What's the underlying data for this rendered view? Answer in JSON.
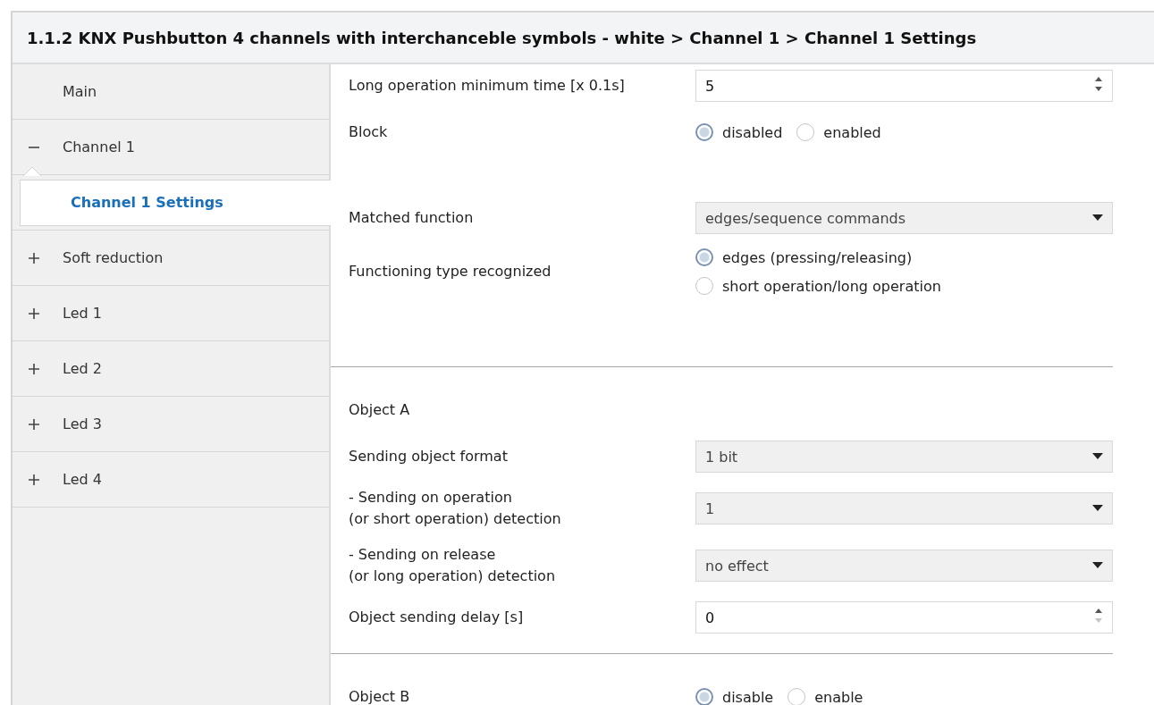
{
  "window": {
    "title": "1.1.2 KNX Pushbutton 4 channels with interchanceble symbols - white > Channel 1 > Channel 1 Settings"
  },
  "sidebar": {
    "items": [
      {
        "label": "Main",
        "selected": false
      },
      {
        "label": "Channel 1",
        "selected": false,
        "expanded": true,
        "children": [
          {
            "label": "Channel 1 Settings",
            "selected": true
          }
        ]
      },
      {
        "label": "Soft reduction",
        "selected": false,
        "expanded": false
      },
      {
        "label": "Led 1",
        "selected": false,
        "expanded": false
      },
      {
        "label": "Led 2",
        "selected": false,
        "expanded": false
      },
      {
        "label": "Led 3",
        "selected": false,
        "expanded": false
      },
      {
        "label": "Led 4",
        "selected": false,
        "expanded": false
      }
    ]
  },
  "sections": [
    {
      "divider": false,
      "rows": [
        {
          "kind": "number",
          "label": "Long operation minimum time [x 0.1s]",
          "value": "5",
          "at_minimum": false
        },
        {
          "kind": "radio_inline",
          "label": "Block",
          "options": [
            {
              "label": "disabled",
              "selected": true
            },
            {
              "label": "enabled",
              "selected": false
            }
          ]
        }
      ]
    },
    {
      "divider": false,
      "rows": [
        {
          "kind": "select",
          "label": "Matched function",
          "value": "edges/sequence commands"
        },
        {
          "kind": "radio_stacked",
          "label": "Functioning type recognized",
          "options": [
            {
              "label": "edges (pressing/releasing)",
              "selected": true
            },
            {
              "label": "short operation/long operation",
              "selected": false
            }
          ]
        }
      ]
    },
    {
      "divider": true,
      "rows": [
        {
          "kind": "heading",
          "label": "Object A"
        },
        {
          "kind": "select",
          "label": "Sending object format",
          "value": "1 bit"
        },
        {
          "kind": "select",
          "label": "- Sending on operation\n(or short operation) detection",
          "value": "1"
        },
        {
          "kind": "select",
          "label": "- Sending on release\n(or long operation) detection",
          "value": "no effect"
        },
        {
          "kind": "number",
          "label": "Object sending delay [s]",
          "value": "0",
          "at_minimum": true
        }
      ]
    },
    {
      "divider": true,
      "rows": [
        {
          "kind": "radio_inline",
          "label": "Object B",
          "options": [
            {
              "label": "disable",
              "selected": true
            },
            {
              "label": "enable",
              "selected": false
            }
          ]
        }
      ]
    }
  ]
}
